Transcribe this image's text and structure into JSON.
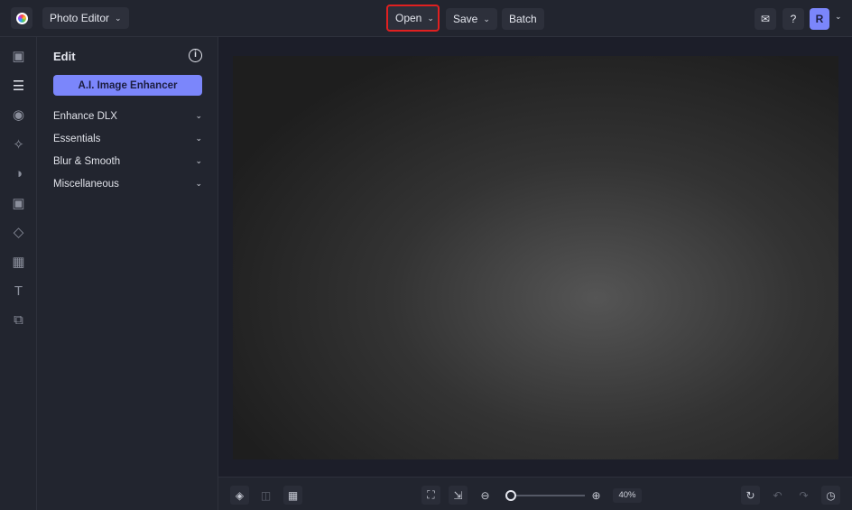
{
  "header": {
    "app_menu": "Photo Editor",
    "open": "Open",
    "save": "Save",
    "batch": "Batch",
    "avatar": "R"
  },
  "rail": [
    "image",
    "adjust",
    "eye",
    "effects",
    "palette",
    "frame",
    "shapes",
    "texture",
    "text",
    "overlay"
  ],
  "panel": {
    "title": "Edit",
    "ai_button": "A.I. Image Enhancer",
    "sections": [
      "Enhance DLX",
      "Essentials",
      "Blur & Smooth",
      "Miscellaneous"
    ]
  },
  "bottom": {
    "zoom": "40%",
    "zoom_fraction": 0.05
  },
  "colors": {
    "accent": "#7b86fb",
    "highlight": "#e02020"
  }
}
